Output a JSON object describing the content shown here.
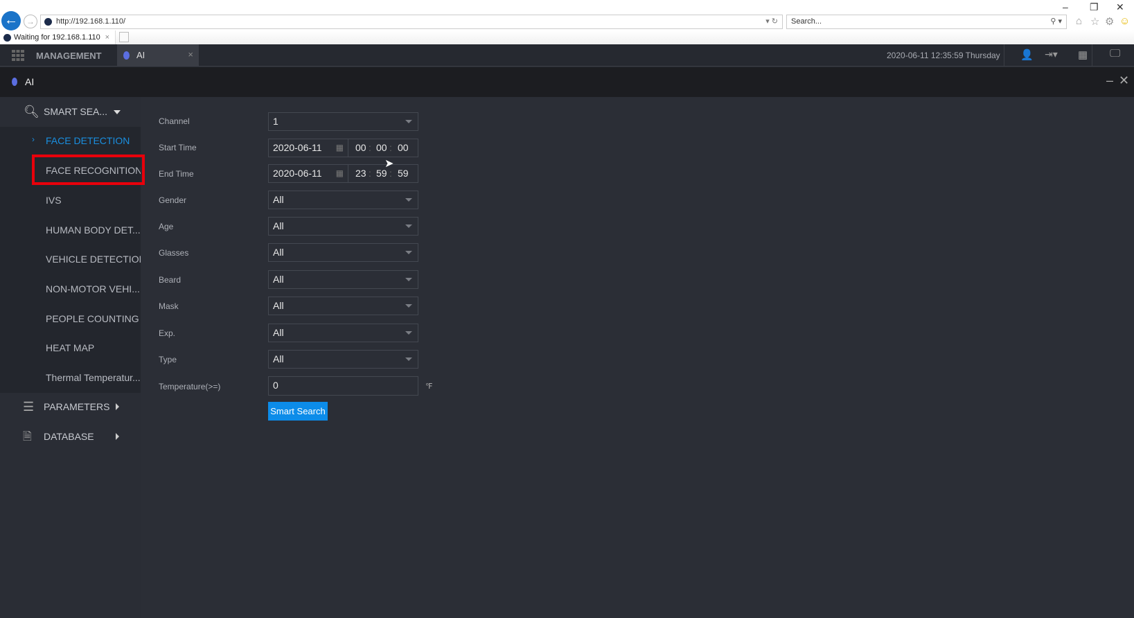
{
  "browser": {
    "url": "http://192.168.1.110/",
    "search_placeholder": "Search...",
    "tab_title": "Waiting for 192.168.1.110"
  },
  "app": {
    "management_label": "MANAGEMENT",
    "tab_label": "AI",
    "datetime": "2020-06-11 12:35:59 Thursday",
    "window_title": "AI"
  },
  "sidebar": {
    "smart_search": "SMART SEA...",
    "items": [
      {
        "label": "FACE DETECTION"
      },
      {
        "label": "FACE RECOGNITION"
      },
      {
        "label": "IVS"
      },
      {
        "label": "HUMAN BODY DET..."
      },
      {
        "label": "VEHICLE DETECTION"
      },
      {
        "label": "NON-MOTOR VEHI..."
      },
      {
        "label": "PEOPLE COUNTING"
      },
      {
        "label": "HEAT MAP"
      },
      {
        "label": "Thermal Temperatur..."
      }
    ],
    "parameters": "PARAMETERS",
    "database": "DATABASE",
    "active_color": "#1a8fe0",
    "highlight_color": "#e8000b"
  },
  "form": {
    "channel": {
      "label": "Channel",
      "value": "1"
    },
    "start": {
      "label": "Start Time",
      "date": "2020-06-11",
      "h": "00",
      "m": "00",
      "s": "00"
    },
    "end": {
      "label": "End Time",
      "date": "2020-06-11",
      "h": "23",
      "m": "59",
      "s": "59"
    },
    "selects": [
      {
        "label": "Gender",
        "value": "All"
      },
      {
        "label": "Age",
        "value": "All"
      },
      {
        "label": "Glasses",
        "value": "All"
      },
      {
        "label": "Beard",
        "value": "All"
      },
      {
        "label": "Mask",
        "value": "All"
      },
      {
        "label": "Exp.",
        "value": "All"
      },
      {
        "label": "Type",
        "value": "All"
      }
    ],
    "temperature": {
      "label": "Temperature(>=)",
      "value": "0",
      "unit": "℉"
    },
    "search_button": "Smart Search"
  }
}
